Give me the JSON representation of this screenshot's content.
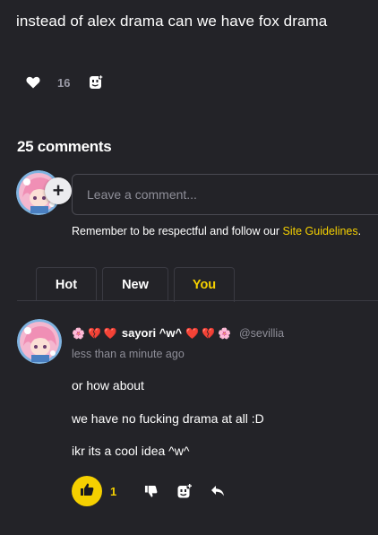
{
  "post": {
    "title": "instead of alex drama can we have fox drama",
    "like_count": "16"
  },
  "comments_section": {
    "count_label": "25 comments",
    "input_placeholder": "Leave a comment...",
    "plus_label": "+",
    "guidelines_prefix": "Remember to be respectful and follow our ",
    "guidelines_link": "Site Guidelines",
    "guidelines_suffix": ".",
    "tabs": [
      {
        "label": "Hot",
        "active": false
      },
      {
        "label": "New",
        "active": false
      },
      {
        "label": "You",
        "active": true
      }
    ]
  },
  "comment": {
    "username_prefix_glyphs": [
      "🌸",
      "💔",
      "❤️"
    ],
    "username": "sayori ^w^",
    "username_suffix_glyphs": [
      "❤️",
      "💔",
      "🌸"
    ],
    "handle": "@sevillia",
    "timestamp": "less than a minute ago",
    "lines": [
      "or how about",
      "we have no fucking drama at all :D",
      "ikr its a cool idea ^w^"
    ],
    "like_count": "1"
  },
  "icons": {
    "post_like": "heart-icon",
    "post_react": "react-face-icon",
    "comment_like": "thumbs-up-icon",
    "comment_dislike": "thumbs-down-icon",
    "comment_react": "add-reaction-icon",
    "comment_reply": "reply-icon"
  },
  "colors": {
    "background": "#232328",
    "accent": "#f5d000",
    "muted_text": "#8e8e98",
    "border": "#3a3a42"
  }
}
